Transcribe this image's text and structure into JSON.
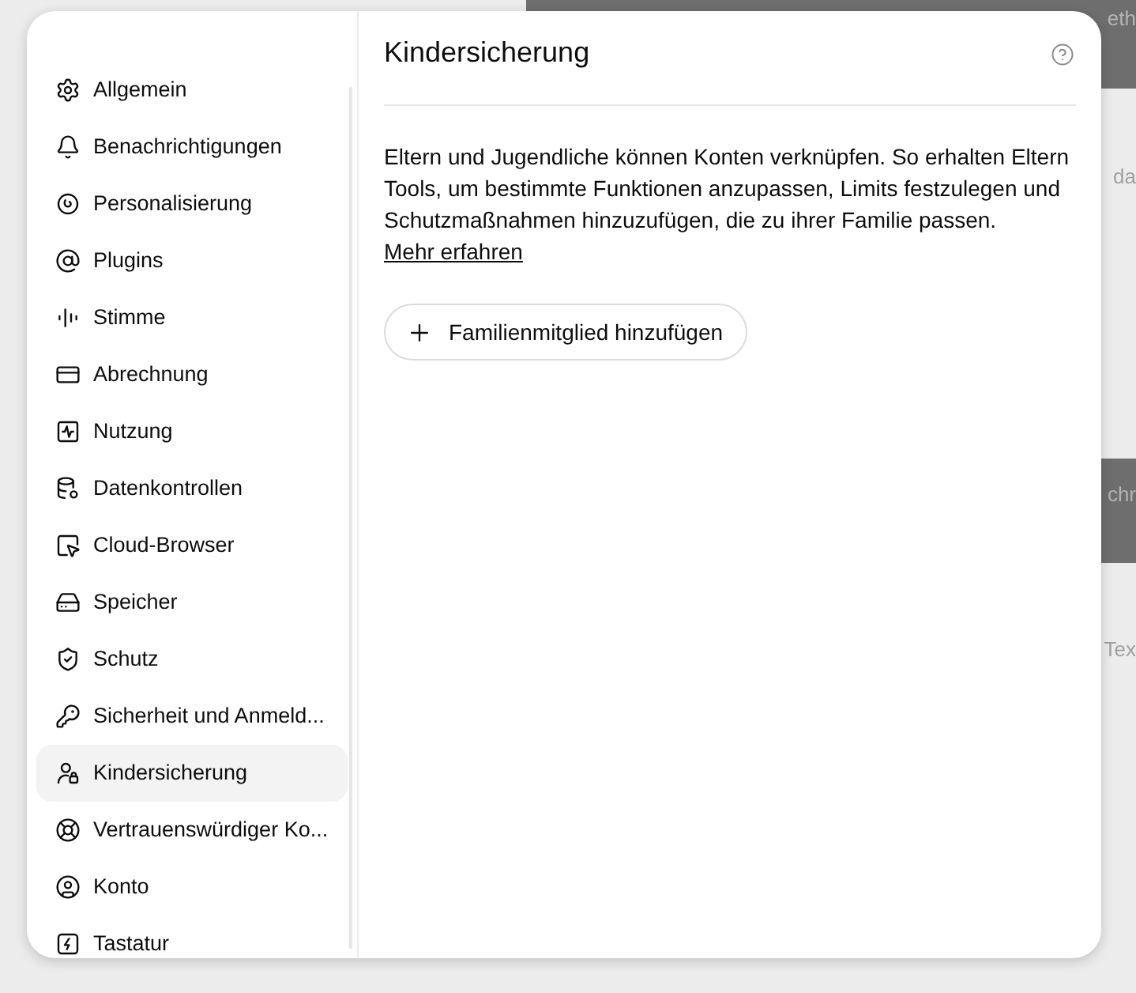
{
  "background": {
    "fragments": [
      {
        "kind": "bar",
        "text": "eth"
      },
      {
        "kind": "text",
        "text": "da"
      },
      {
        "kind": "bar",
        "text": "chr"
      },
      {
        "kind": "text",
        "text": "Tex"
      }
    ]
  },
  "sidebar": {
    "items": [
      {
        "label": "Allgemein",
        "selected": false
      },
      {
        "label": "Benachrichtigungen",
        "selected": false
      },
      {
        "label": "Personalisierung",
        "selected": false
      },
      {
        "label": "Plugins",
        "selected": false
      },
      {
        "label": "Stimme",
        "selected": false
      },
      {
        "label": "Abrechnung",
        "selected": false
      },
      {
        "label": "Nutzung",
        "selected": false
      },
      {
        "label": "Datenkontrollen",
        "selected": false
      },
      {
        "label": "Cloud-Browser",
        "selected": false
      },
      {
        "label": "Speicher",
        "selected": false
      },
      {
        "label": "Schutz",
        "selected": false
      },
      {
        "label": "Sicherheit und Anmeld...",
        "selected": false
      },
      {
        "label": "Kindersicherung",
        "selected": true
      },
      {
        "label": "Vertrauenswürdiger Ko...",
        "selected": false
      },
      {
        "label": "Konto",
        "selected": false
      },
      {
        "label": "Tastatur",
        "selected": false
      }
    ]
  },
  "panel": {
    "title": "Kindersicherung",
    "description": {
      "text": "Eltern und Jugendliche können Konten verknüpfen. So erhalten Eltern Tools, um bestimmte Funktionen anzupassen, Limits festzulegen und Schutzmaßnahmen hinzuzufügen, die zu ihrer Familie passen.",
      "link": "Mehr erfahren"
    },
    "add_button": {
      "label": "Familienmitglied hinzufügen"
    }
  }
}
